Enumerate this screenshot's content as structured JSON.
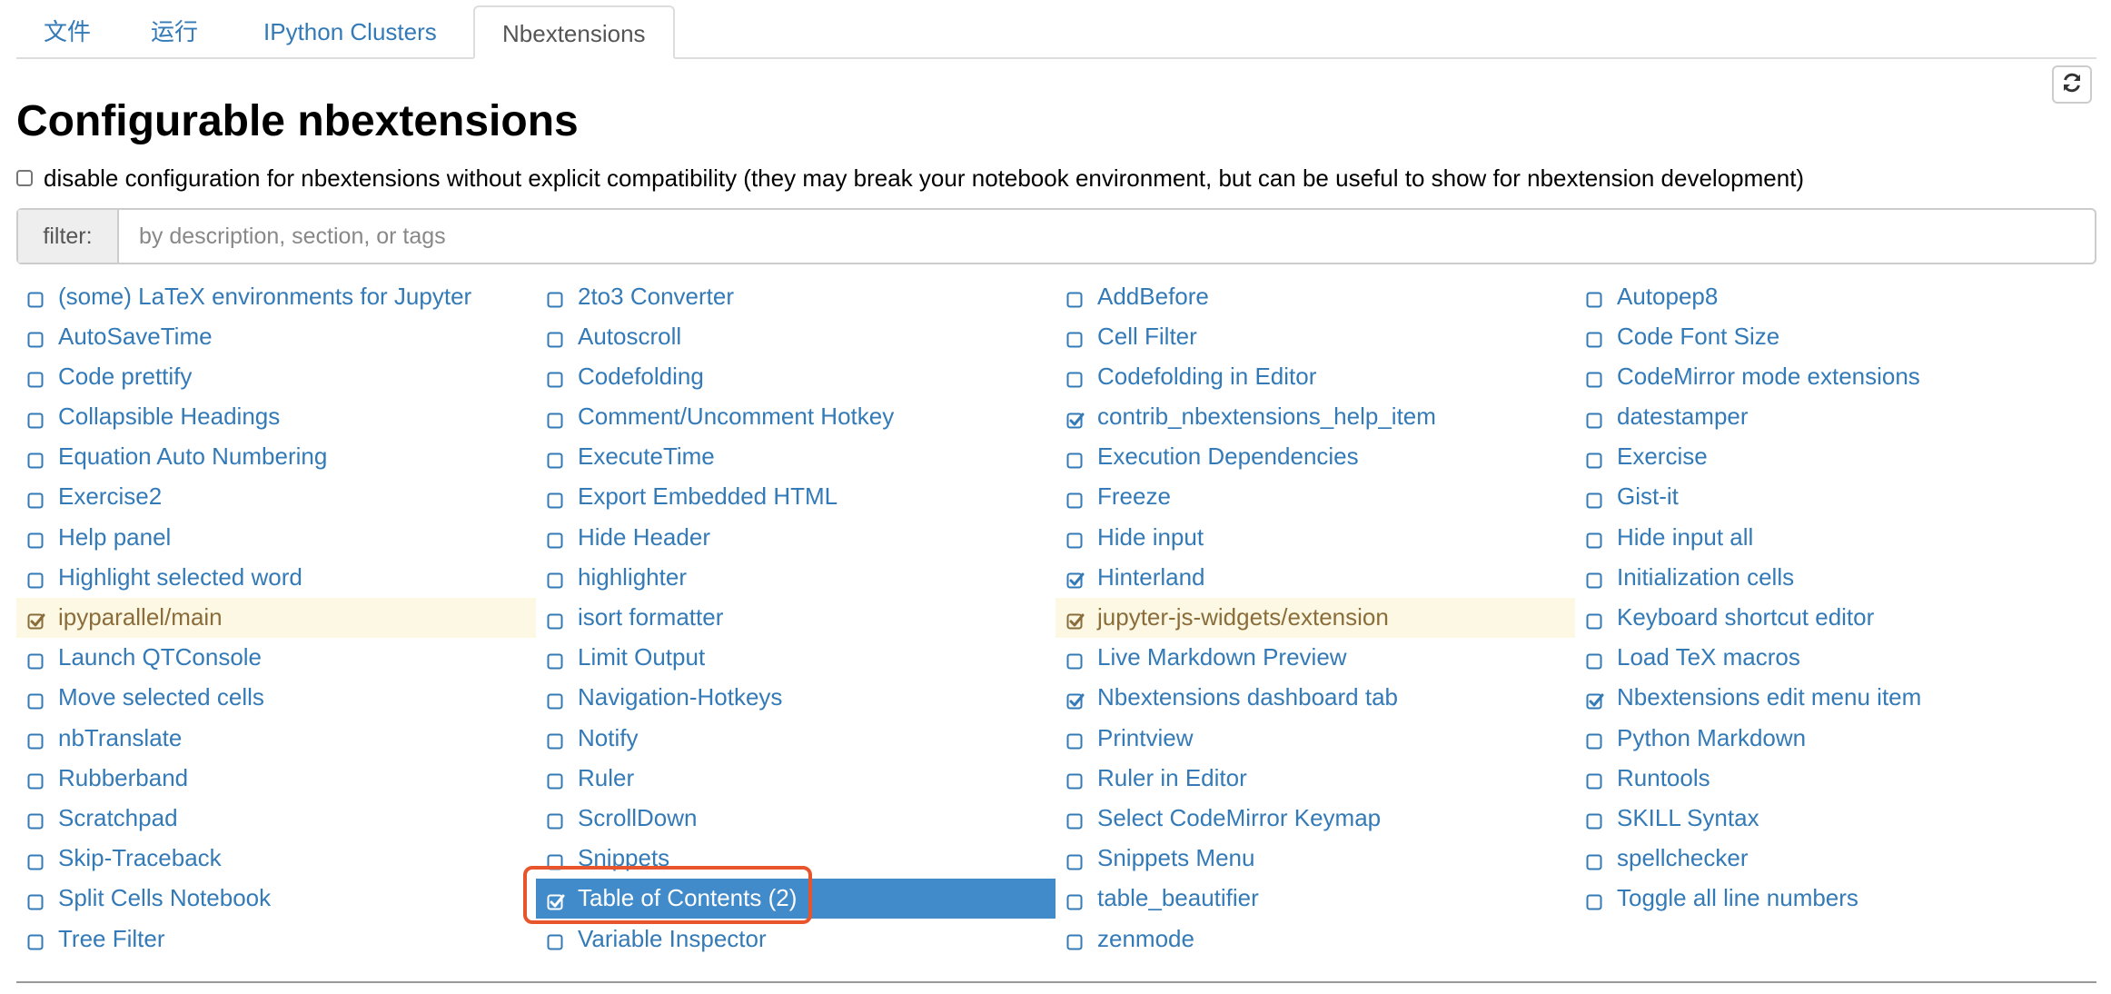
{
  "tabs": [
    {
      "label": "文件",
      "active": false
    },
    {
      "label": "运行",
      "active": false
    },
    {
      "label": "IPython Clusters",
      "active": false
    },
    {
      "label": "Nbextensions",
      "active": true
    }
  ],
  "refresh": {
    "icon": "refresh-icon"
  },
  "page_title": "Configurable nbextensions",
  "disable_option": {
    "checked": false,
    "label": "disable configuration for nbextensions without explicit compatibility (they may break your notebook environment, but can be useful to show for nbextension development)"
  },
  "filter": {
    "label": "filter:",
    "placeholder": "by description, section, or tags",
    "value": ""
  },
  "colors": {
    "link": "#337ab7",
    "highlight_bg": "#fcf8e3",
    "highlight_text": "#8a6d3b",
    "selected_bg": "#428bca",
    "focus_ring": "#e8542c"
  },
  "extensions": [
    {
      "label": "(some) LaTeX environments for Jupyter",
      "checked": false
    },
    {
      "label": "2to3 Converter",
      "checked": false
    },
    {
      "label": "AddBefore",
      "checked": false
    },
    {
      "label": "Autopep8",
      "checked": false
    },
    {
      "label": "AutoSaveTime",
      "checked": false
    },
    {
      "label": "Autoscroll",
      "checked": false
    },
    {
      "label": "Cell Filter",
      "checked": false
    },
    {
      "label": "Code Font Size",
      "checked": false
    },
    {
      "label": "Code prettify",
      "checked": false
    },
    {
      "label": "Codefolding",
      "checked": false
    },
    {
      "label": "Codefolding in Editor",
      "checked": false
    },
    {
      "label": "CodeMirror mode extensions",
      "checked": false
    },
    {
      "label": "Collapsible Headings",
      "checked": false
    },
    {
      "label": "Comment/Uncomment Hotkey",
      "checked": false
    },
    {
      "label": "contrib_nbextensions_help_item",
      "checked": true
    },
    {
      "label": "datestamper",
      "checked": false
    },
    {
      "label": "Equation Auto Numbering",
      "checked": false
    },
    {
      "label": "ExecuteTime",
      "checked": false
    },
    {
      "label": "Execution Dependencies",
      "checked": false
    },
    {
      "label": "Exercise",
      "checked": false
    },
    {
      "label": "Exercise2",
      "checked": false
    },
    {
      "label": "Export Embedded HTML",
      "checked": false
    },
    {
      "label": "Freeze",
      "checked": false
    },
    {
      "label": "Gist-it",
      "checked": false
    },
    {
      "label": "Help panel",
      "checked": false
    },
    {
      "label": "Hide Header",
      "checked": false
    },
    {
      "label": "Hide input",
      "checked": false
    },
    {
      "label": "Hide input all",
      "checked": false
    },
    {
      "label": "Highlight selected word",
      "checked": false
    },
    {
      "label": "highlighter",
      "checked": false
    },
    {
      "label": "Hinterland",
      "checked": true
    },
    {
      "label": "Initialization cells",
      "checked": false
    },
    {
      "label": "ipyparallel/main",
      "checked": true,
      "state": "highlight"
    },
    {
      "label": "isort formatter",
      "checked": false
    },
    {
      "label": "jupyter-js-widgets/extension",
      "checked": true,
      "state": "highlight"
    },
    {
      "label": "Keyboard shortcut editor",
      "checked": false
    },
    {
      "label": "Launch QTConsole",
      "checked": false
    },
    {
      "label": "Limit Output",
      "checked": false
    },
    {
      "label": "Live Markdown Preview",
      "checked": false
    },
    {
      "label": "Load TeX macros",
      "checked": false
    },
    {
      "label": "Move selected cells",
      "checked": false
    },
    {
      "label": "Navigation-Hotkeys",
      "checked": false
    },
    {
      "label": "Nbextensions dashboard tab",
      "checked": true
    },
    {
      "label": "Nbextensions edit menu item",
      "checked": true
    },
    {
      "label": "nbTranslate",
      "checked": false
    },
    {
      "label": "Notify",
      "checked": false
    },
    {
      "label": "Printview",
      "checked": false
    },
    {
      "label": "Python Markdown",
      "checked": false
    },
    {
      "label": "Rubberband",
      "checked": false
    },
    {
      "label": "Ruler",
      "checked": false
    },
    {
      "label": "Ruler in Editor",
      "checked": false
    },
    {
      "label": "Runtools",
      "checked": false
    },
    {
      "label": "Scratchpad",
      "checked": false
    },
    {
      "label": "ScrollDown",
      "checked": false
    },
    {
      "label": "Select CodeMirror Keymap",
      "checked": false
    },
    {
      "label": "SKILL Syntax",
      "checked": false
    },
    {
      "label": "Skip-Traceback",
      "checked": false
    },
    {
      "label": "Snippets",
      "checked": false
    },
    {
      "label": "Snippets Menu",
      "checked": false
    },
    {
      "label": "spellchecker",
      "checked": false
    },
    {
      "label": "Split Cells Notebook",
      "checked": false
    },
    {
      "label": "Table of Contents (2)",
      "checked": true,
      "state": "selected"
    },
    {
      "label": "table_beautifier",
      "checked": false
    },
    {
      "label": "Toggle all line numbers",
      "checked": false
    },
    {
      "label": "Tree Filter",
      "checked": false
    },
    {
      "label": "Variable Inspector",
      "checked": false
    },
    {
      "label": "zenmode",
      "checked": false
    }
  ]
}
